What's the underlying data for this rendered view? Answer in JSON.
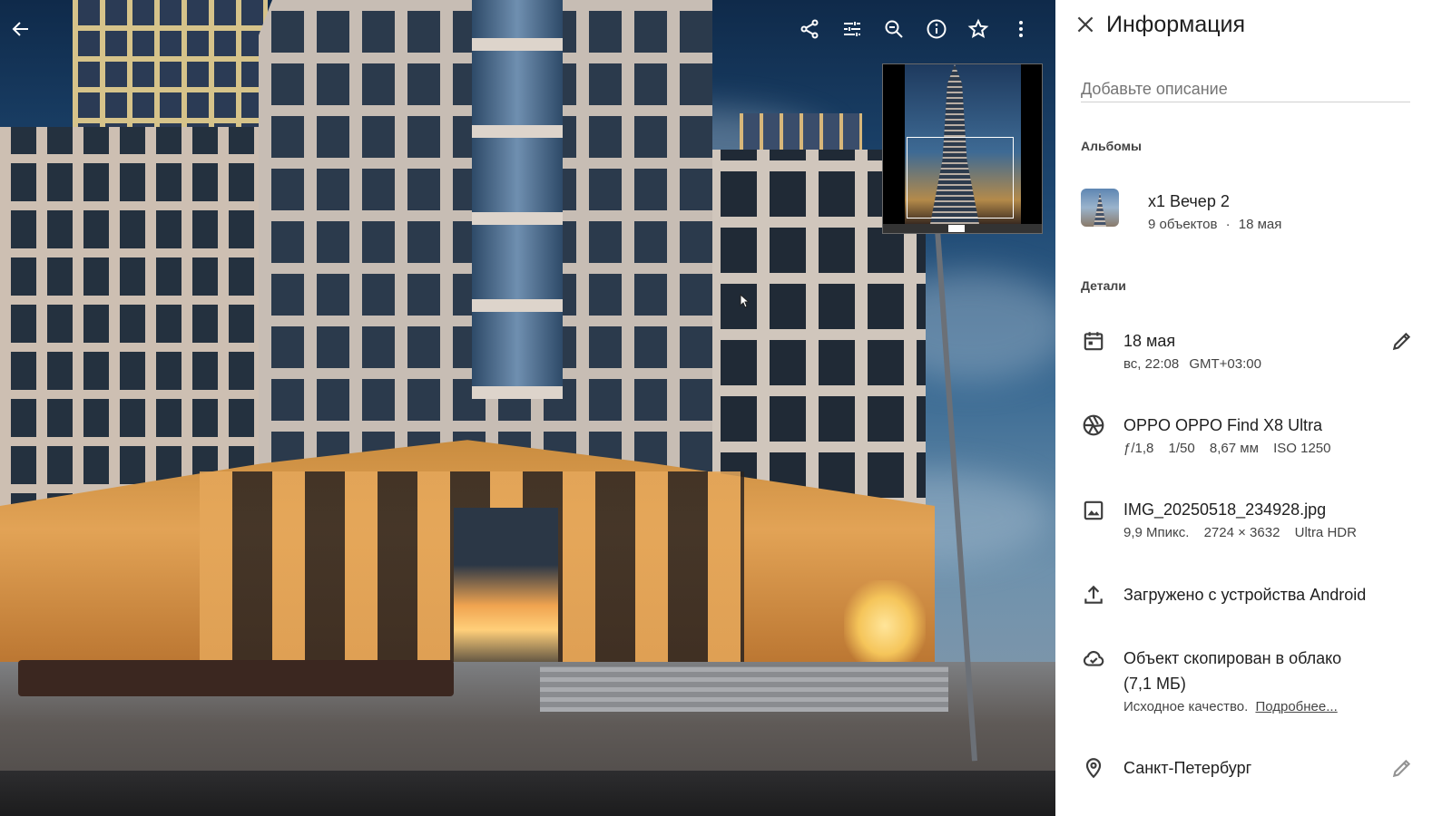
{
  "viewer": {
    "toolbar": [
      {
        "name": "share-icon"
      },
      {
        "name": "edit-adjust-icon"
      },
      {
        "name": "zoom-out-icon"
      },
      {
        "name": "info-icon"
      },
      {
        "name": "star-icon"
      },
      {
        "name": "more-vert-icon"
      }
    ]
  },
  "info": {
    "title": "Информация",
    "description_placeholder": "Добавьте описание",
    "albums_heading": "Альбомы",
    "album": {
      "name": "x1 Вечер 2",
      "count": "9 объектов",
      "separator": "·",
      "date": "18 мая"
    },
    "details_heading": "Детали",
    "date_row": {
      "date": "18 мая",
      "weekday_time": "вс, 22:08",
      "timezone": "GMT+03:00"
    },
    "camera_row": {
      "model": "OPPO OPPO Find X8 Ultra",
      "aperture": "ƒ/1,8",
      "shutter": "1/50",
      "focal": "8,67 мм",
      "iso": "ISO 1250"
    },
    "file_row": {
      "filename": "IMG_20250518_234928.jpg",
      "megapixels": "9,9 Мпикс.",
      "resolution": "2724 × 3632",
      "format": "Ultra HDR"
    },
    "upload_row": {
      "text": "Загружено с устройства Android"
    },
    "cloud_row": {
      "line1": "Объект скопирован в облако",
      "line2": "(7,1 МБ)",
      "quality": "Исходное качество.",
      "more_link": "Подробнее..."
    },
    "location_row": {
      "place": "Санкт-Петербург"
    }
  },
  "colors": {
    "panel_bg": "#ffffff",
    "text_primary": "#1f1f1f",
    "text_secondary": "#444444"
  }
}
